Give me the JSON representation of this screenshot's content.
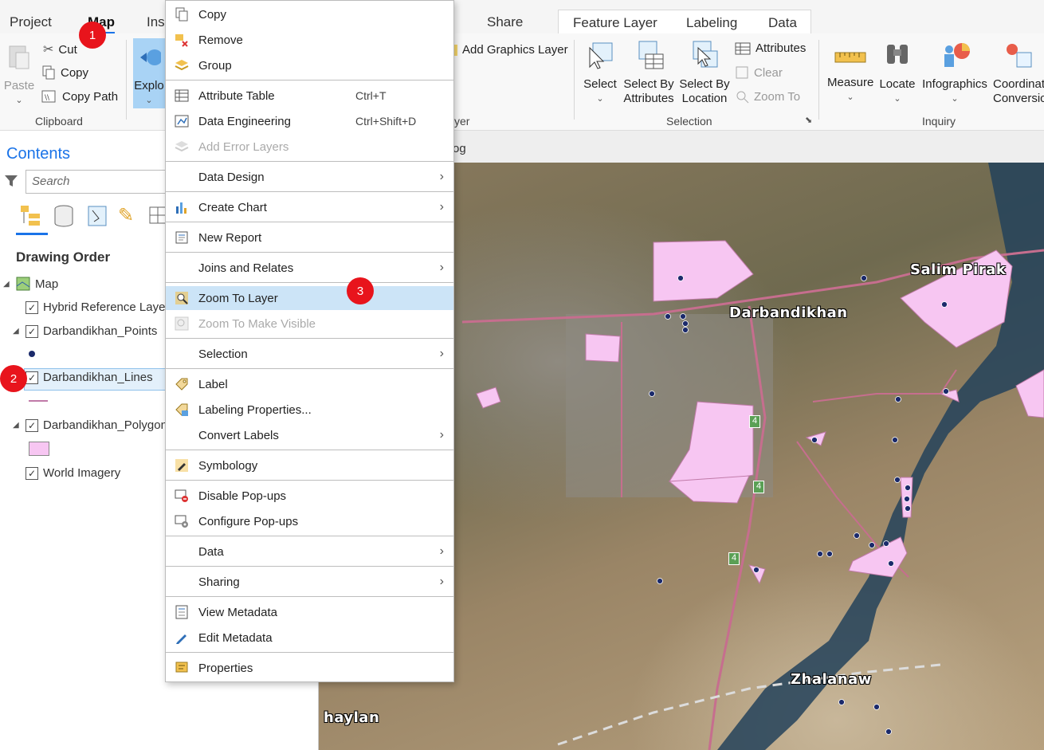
{
  "ribbon": {
    "tabs": {
      "project": "Project",
      "map": "Map",
      "insert": "Ins",
      "share": "Share"
    },
    "context_tabs": {
      "feature_layer": "Feature Layer",
      "labeling": "Labeling",
      "data": "Data"
    },
    "clipboard": {
      "paste": "Paste",
      "cut": "Cut",
      "copy": "Copy",
      "copy_path": "Copy Path",
      "group_label": "Clipboard"
    },
    "navigate": {
      "explore": "Explo"
    },
    "layer": {
      "add_graphics_layer": "Add Graphics Layer",
      "group_label_fragment": "yer"
    },
    "selection": {
      "select": "Select",
      "select_by_attributes_1": "Select By",
      "select_by_attributes_2": "Attributes",
      "select_by_location_1": "Select By",
      "select_by_location_2": "Location",
      "attributes": "Attributes",
      "clear": "Clear",
      "zoom_to": "Zoom To",
      "group_label": "Selection"
    },
    "inquiry": {
      "measure": "Measure",
      "locate": "Locate",
      "infographics": "Infographics",
      "coordinate_1": "Coordinat",
      "coordinate_2": "Conversic",
      "group_label": "Inquiry"
    }
  },
  "contents": {
    "title": "Contents",
    "search_placeholder": "Search",
    "drawing_order": "Drawing Order",
    "layers": {
      "map": "Map",
      "hybrid": "Hybrid Reference Layer",
      "points": "Darbandikhan_Points",
      "lines": "Darbandikhan_Lines",
      "polygons": "Darbandikhan_Polygons",
      "imagery": "World Imagery"
    }
  },
  "map": {
    "tab_fragment": "og",
    "labels": {
      "darbandikhan": "Darbandikhan",
      "salim_pirak": "Salim Pirak",
      "zhalanaw": "Zhalanaw",
      "haylan": "haylan"
    },
    "road_shield": "4"
  },
  "context_menu": {
    "copy": "Copy",
    "remove": "Remove",
    "group": "Group",
    "attribute_table": "Attribute Table",
    "attribute_table_sc": "Ctrl+T",
    "data_engineering": "Data Engineering",
    "data_engineering_sc": "Ctrl+Shift+D",
    "add_error_layers": "Add Error Layers",
    "data_design": "Data Design",
    "create_chart": "Create Chart",
    "new_report": "New Report",
    "joins_relates": "Joins and Relates",
    "zoom_to_layer": "Zoom To Layer",
    "zoom_to_visible": "Zoom To Make Visible",
    "selection": "Selection",
    "label": "Label",
    "labeling_properties": "Labeling Properties...",
    "convert_labels": "Convert Labels",
    "symbology": "Symbology",
    "disable_popups": "Disable Pop-ups",
    "configure_popups": "Configure Pop-ups",
    "data": "Data",
    "sharing": "Sharing",
    "view_metadata": "View Metadata",
    "edit_metadata": "Edit Metadata",
    "properties": "Properties"
  },
  "badges": {
    "one": "1",
    "two": "2",
    "three": "3"
  },
  "colors": {
    "accent": "#1a73e8",
    "badge": "#e8141c",
    "polygon_fill": "#f7c6f2",
    "highlight": "#cce4f7"
  }
}
